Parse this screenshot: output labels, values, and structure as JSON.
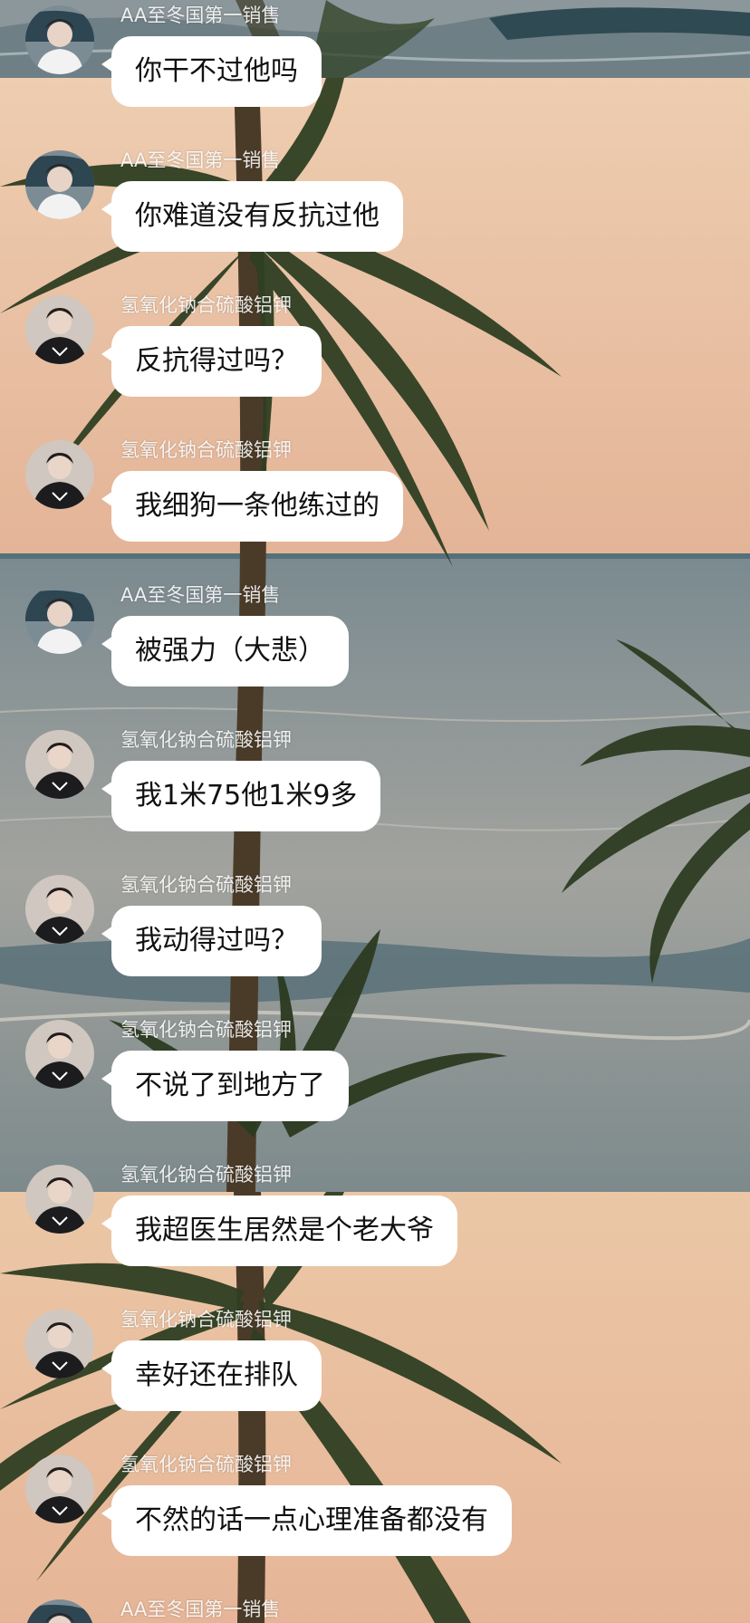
{
  "theme": {
    "bubble_color": "#ffffff",
    "sky_color": "#eac5a3",
    "sea_color": "#7d8c94"
  },
  "avatars": {
    "user_a": "avatar-person-white-sweater",
    "user_b": "avatar-person-black-jacket"
  },
  "messages": [
    {
      "sender": "AA至冬国第一销售",
      "avatar": "user_a",
      "text": "你干不过他吗"
    },
    {
      "sender": "AA至冬国第一销售",
      "avatar": "user_a",
      "text": "你难道没有反抗过他"
    },
    {
      "sender": "氢氧化钠合硫酸铝钾",
      "avatar": "user_b",
      "text": "反抗得过吗？"
    },
    {
      "sender": "氢氧化钠合硫酸铝钾",
      "avatar": "user_b",
      "text": "我细狗一条他练过的"
    },
    {
      "sender": "AA至冬国第一销售",
      "avatar": "user_a",
      "text": "被强力（大悲）"
    },
    {
      "sender": "氢氧化钠合硫酸铝钾",
      "avatar": "user_b",
      "text": "我1米75他1米9多"
    },
    {
      "sender": "氢氧化钠合硫酸铝钾",
      "avatar": "user_b",
      "text": "我动得过吗？"
    },
    {
      "sender": "氢氧化钠合硫酸铝钾",
      "avatar": "user_b",
      "text": "不说了到地方了"
    },
    {
      "sender": "氢氧化钠合硫酸铝钾",
      "avatar": "user_b",
      "text": "我超医生居然是个老大爷"
    },
    {
      "sender": "氢氧化钠合硫酸铝钾",
      "avatar": "user_b",
      "text": "幸好还在排队"
    },
    {
      "sender": "氢氧化钠合硫酸铝钾",
      "avatar": "user_b",
      "text": "不然的话一点心理准备都没有"
    },
    {
      "sender": "AA至冬国第一销售",
      "avatar": "user_a",
      "text": ""
    }
  ]
}
